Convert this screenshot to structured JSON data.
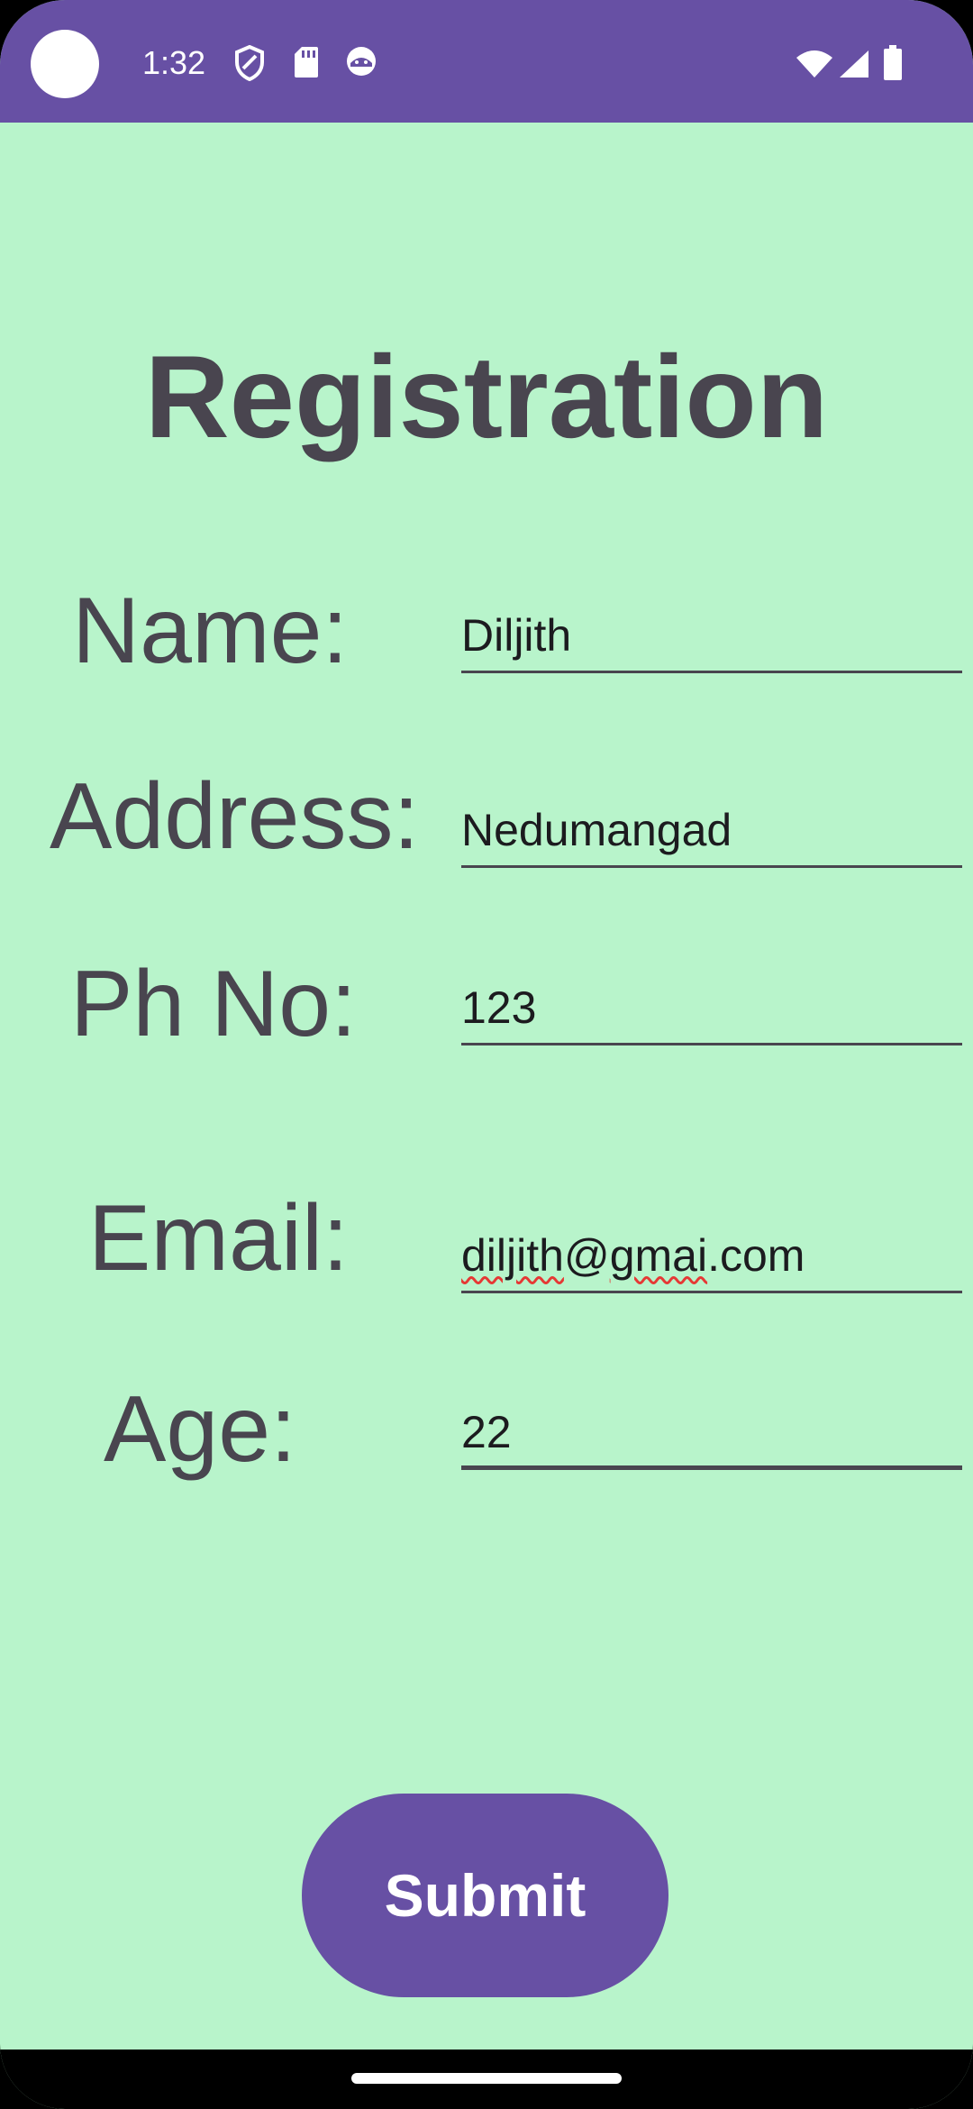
{
  "status_bar": {
    "time": "1:32",
    "icons_left": [
      "shield-icon",
      "sd-card-icon",
      "android-face-icon"
    ],
    "icons_right": [
      "wifi-icon",
      "signal-icon",
      "battery-icon"
    ],
    "background_color": "#6750a4"
  },
  "page": {
    "title": "Registration",
    "background_color": "#b8f4cb",
    "text_color": "#49454f"
  },
  "form": {
    "fields": [
      {
        "label": "Name:",
        "value": "Diljith"
      },
      {
        "label": "Address:",
        "value": "Nedumangad"
      },
      {
        "label": "Ph No:",
        "value": "123"
      },
      {
        "label": "Email:",
        "value_parts": [
          "diljith",
          "@",
          "gmai",
          ".com"
        ],
        "value": "diljith@gmai.com"
      },
      {
        "label": "Age:",
        "value": "22"
      }
    ]
  },
  "submit": {
    "label": "Submit",
    "color": "#6750a4"
  }
}
